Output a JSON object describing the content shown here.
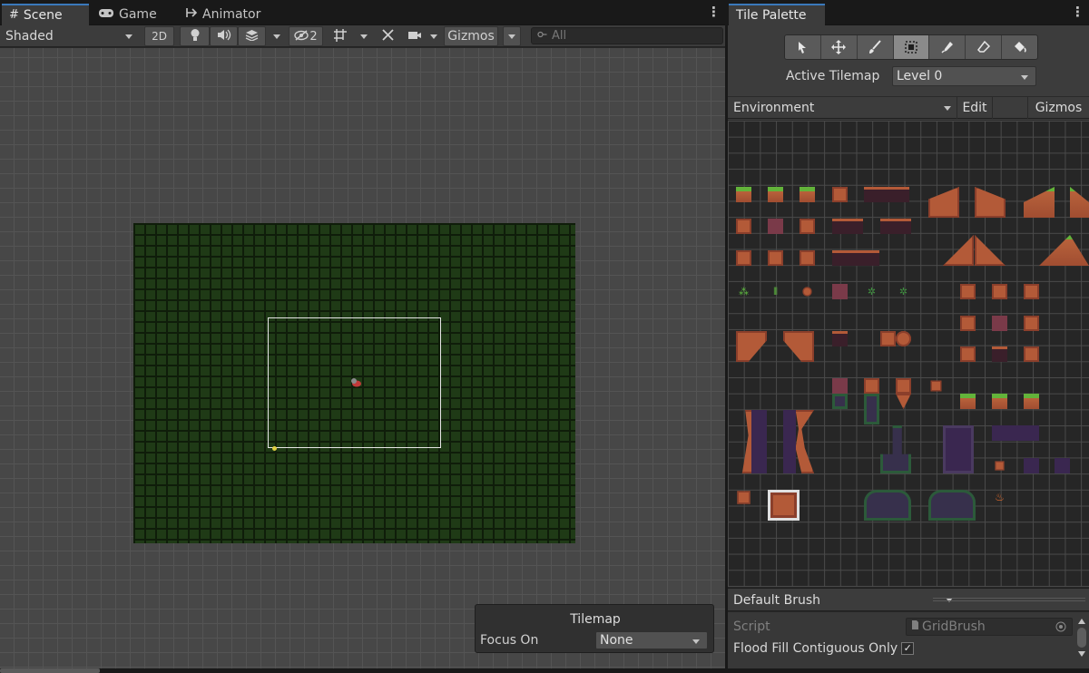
{
  "scene_tabs": {
    "scene": "Scene",
    "game": "Game",
    "animator": "Animator"
  },
  "toolbar": {
    "shading_mode": "Shaded",
    "mode_2d": "2D",
    "hidden_count": "2",
    "gizmos": "Gizmos",
    "search_placeholder": "All"
  },
  "tilemap_overlay": {
    "title": "Tilemap",
    "focus_label": "Focus On",
    "focus_value": "None"
  },
  "tile_palette": {
    "tab": "Tile Palette",
    "active_tilemap_label": "Active Tilemap",
    "active_tilemap_value": "Level 0",
    "palette_name": "Environment",
    "edit": "Edit",
    "gizmos": "Gizmos",
    "tools": [
      "select-icon",
      "move-icon",
      "paintbrush-icon",
      "box-fill-icon",
      "picker-icon",
      "eraser-icon",
      "fill-bucket-icon"
    ],
    "selected_tool": "box-fill-icon",
    "brush": "Default Brush",
    "script_label": "Script",
    "script_value": "GridBrush",
    "flood_fill_label": "Flood Fill Contiguous Only",
    "flood_fill_checked": "✓"
  },
  "colors": {
    "accent": "#3a79bb",
    "panel": "#282828",
    "toolbar": "#3c3c3c"
  }
}
